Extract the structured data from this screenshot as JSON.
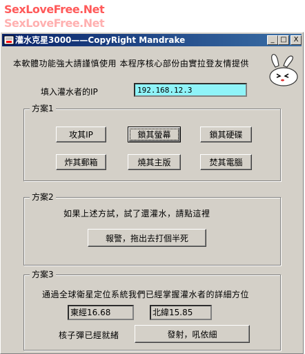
{
  "watermark": {
    "line1": "SexLoveFree.Net",
    "line2": "SexLoveFree.Net"
  },
  "window": {
    "title": "灌水克星3000——CopyRight  Mandrake",
    "controls": {
      "minimize": "_",
      "maximize": "□",
      "close": "X"
    }
  },
  "intro_text": "本軟體功能強大請謹慎使用 本程序核心部份由實拉登友情提供",
  "ip": {
    "label": "填入灌水者的IP",
    "value": "192.168.12.3"
  },
  "plan1": {
    "title": "方案1",
    "buttons": [
      "攻其IP",
      "鎖其螢幕",
      "鎖其硬碟",
      "炸其郵箱",
      "燒其主版",
      "焚其電腦"
    ]
  },
  "plan2": {
    "title": "方案2",
    "text": "如果上述方試，試了還灌水，請點這裡",
    "button": "報警，拖出去打個半死"
  },
  "plan3": {
    "title": "方案3",
    "text": "通過全球衛星定位系統我們已經掌握灌水者的詳細方位",
    "longitude": "東經16.68",
    "latitude": "北緯15.85",
    "nuke_label": "核子彈已經就緒",
    "fire_button": "發射，吼依細"
  }
}
